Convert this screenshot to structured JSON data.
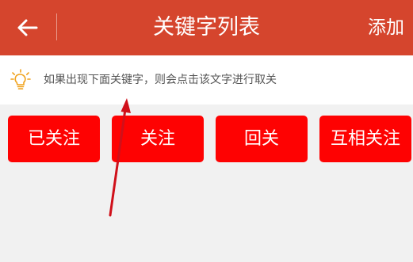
{
  "header": {
    "back_icon": "arrow-left-icon",
    "title": "关键字列表",
    "add_label": "添加"
  },
  "tip": {
    "icon": "lightbulb-icon",
    "text": "如果出现下面关键字，则会点击该文字进行取关"
  },
  "keywords": [
    {
      "label": "已关注"
    },
    {
      "label": "关注"
    },
    {
      "label": "回关"
    },
    {
      "label": "互相关注"
    }
  ],
  "colors": {
    "header_bg": "#d5452d",
    "button_bg": "#fe0202",
    "page_bg": "#f1f1f1",
    "annotation_arrow": "#d0101a",
    "tip_icon": "#f0a21c"
  }
}
